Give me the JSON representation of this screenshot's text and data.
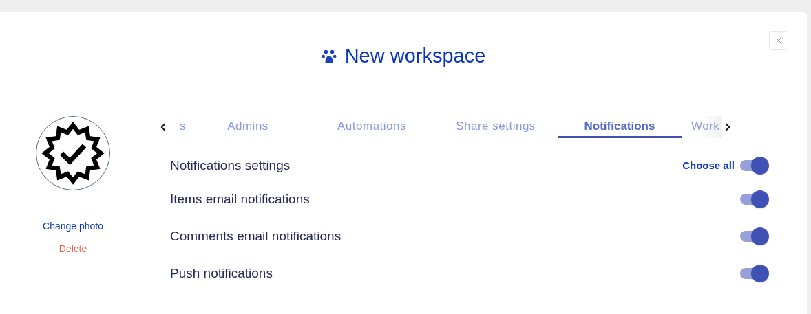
{
  "dialog": {
    "title": "New workspace"
  },
  "photo": {
    "change_label": "Change photo",
    "delete_label": "Delete"
  },
  "tabs": [
    {
      "label": "s",
      "selected": false
    },
    {
      "label": "Admins",
      "selected": false
    },
    {
      "label": "Automations",
      "selected": false
    },
    {
      "label": "Share settings",
      "selected": false
    },
    {
      "label": "Notifications",
      "selected": true
    },
    {
      "label": "Work",
      "selected": false
    }
  ],
  "notifications": {
    "heading": "Notifications settings",
    "choose_all": {
      "label": "Choose all",
      "on": true
    },
    "items": [
      {
        "label": "Items email notifications",
        "on": true
      },
      {
        "label": "Comments email notifications",
        "on": true
      },
      {
        "label": "Push notifications",
        "on": true
      }
    ]
  }
}
